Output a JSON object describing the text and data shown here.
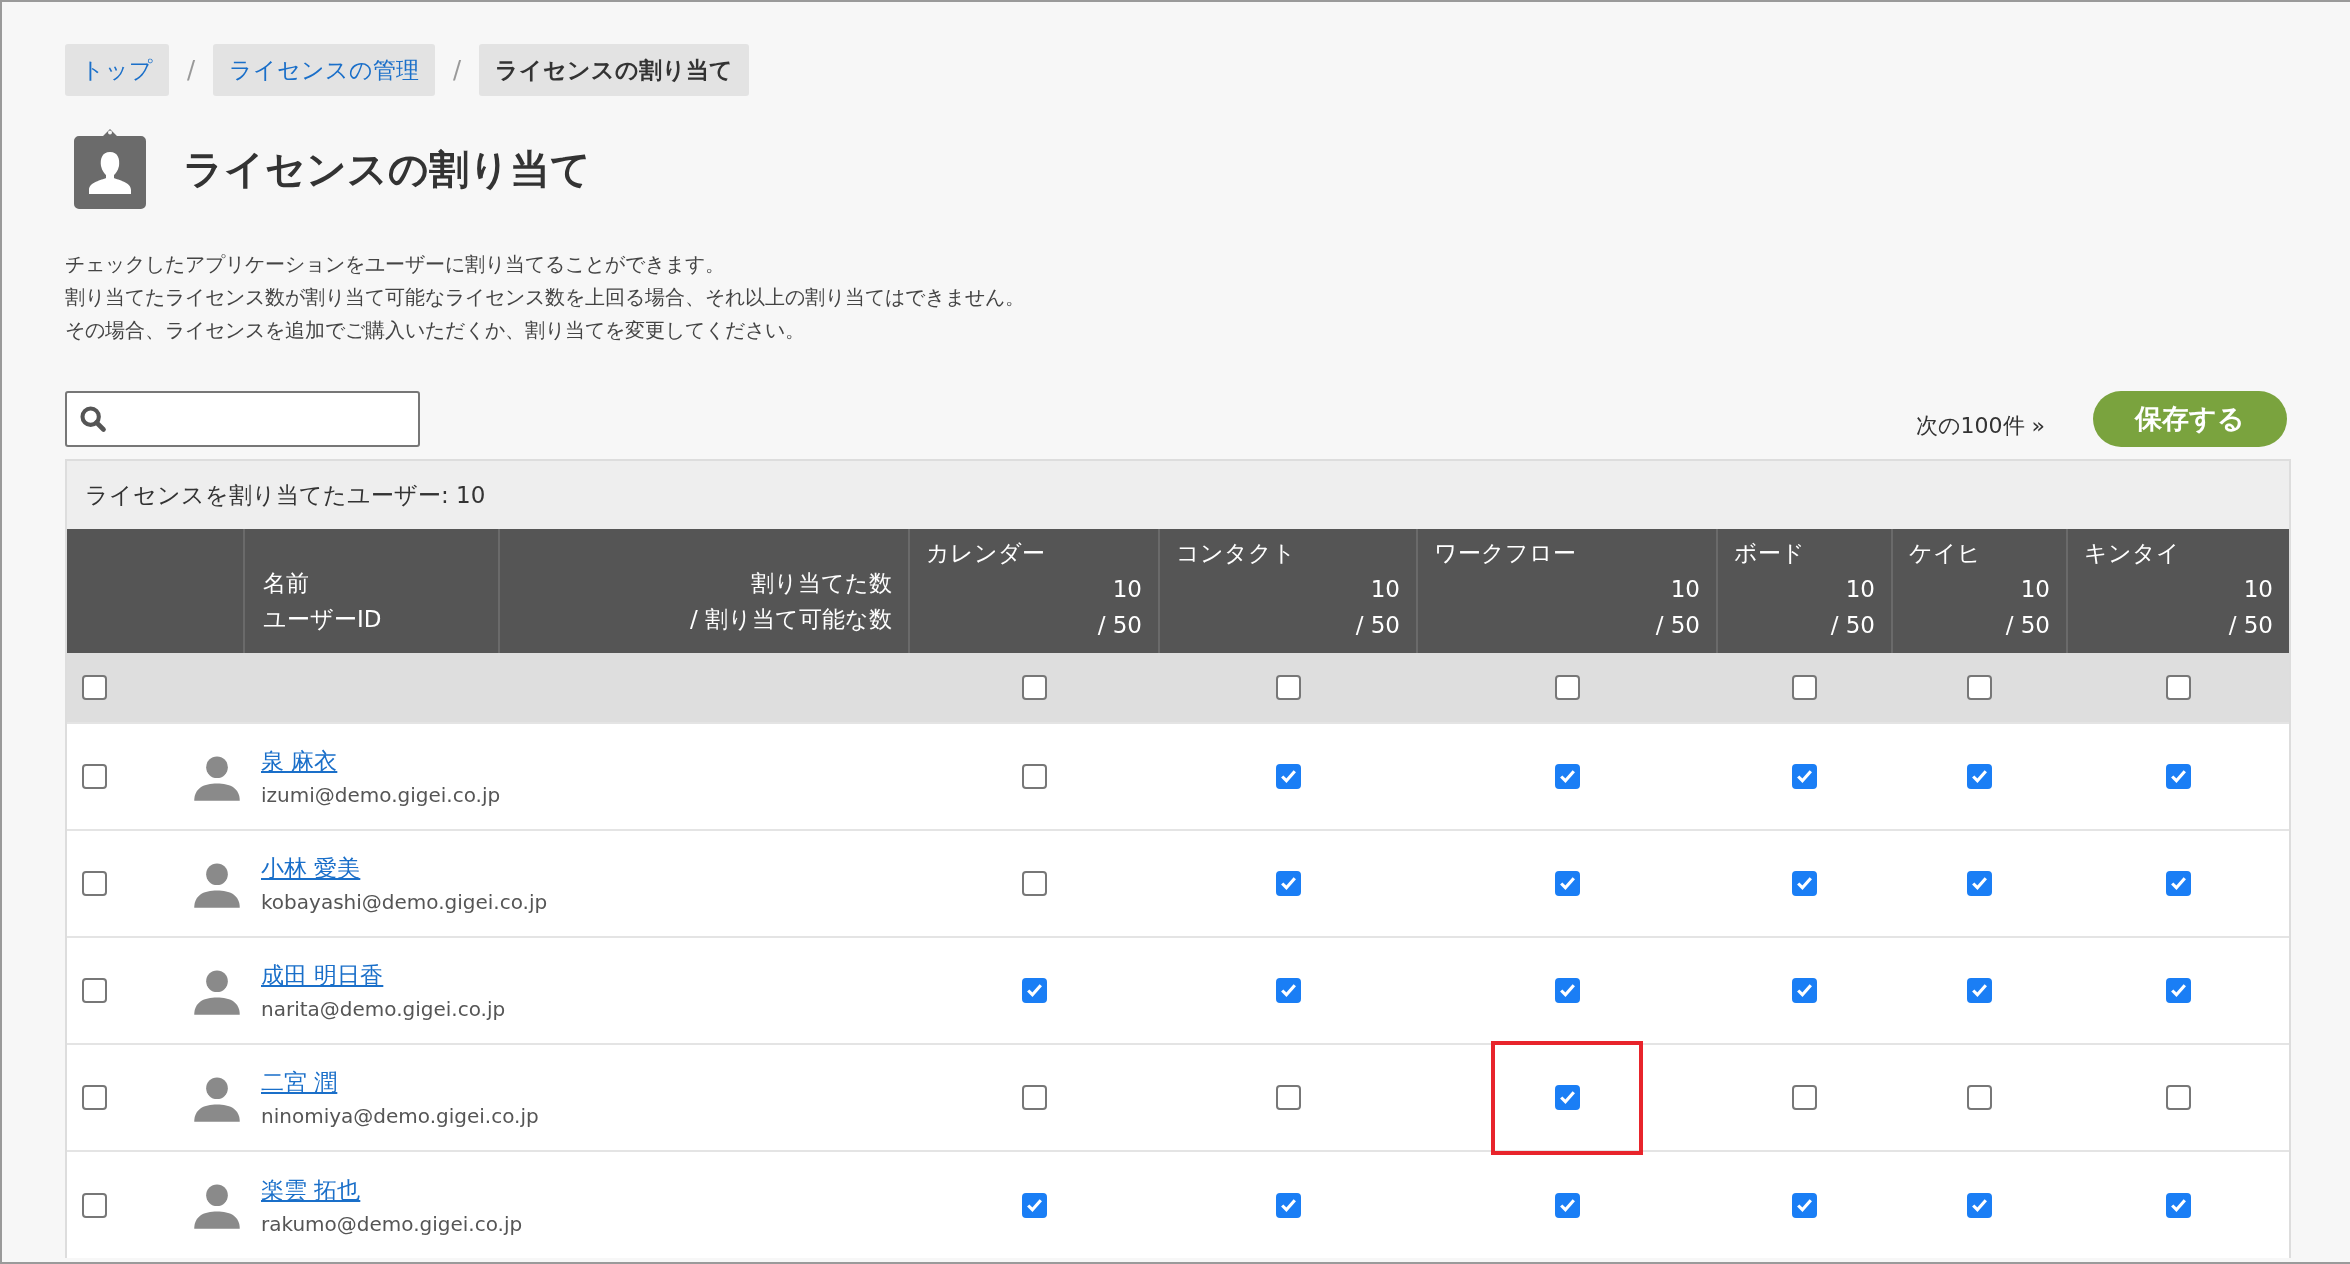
{
  "breadcrumb": [
    {
      "label": "トップ",
      "current": false
    },
    {
      "label": "ライセンスの管理",
      "current": false
    },
    {
      "label": "ライセンスの割り当て",
      "current": true
    }
  ],
  "breadcrumb_separator": "/",
  "title": "ライセンスの割り当て",
  "description": [
    "チェックしたアプリケーションをユーザーに割り当てることができます。",
    "割り当てたライセンス数が割り当て可能なライセンス数を上回る場合、それ以上の割り当てはできません。",
    "その場合、ライセンスを追加でご購入いただくか、割り当てを変更してください。"
  ],
  "next_link": "次の100件 »",
  "save_button": "保存する",
  "summary": "ライセンスを割り当てたユーザー: 10",
  "table": {
    "name_header": [
      "名前",
      "ユーザーID"
    ],
    "count_header": [
      "割り当てた数",
      "/ 割り当て可能な数"
    ],
    "select_all": {
      "checked": false
    },
    "apps": [
      {
        "name": "カレンダー",
        "assigned": "10",
        "total": "/ 50",
        "all_checked": false
      },
      {
        "name": "コンタクト",
        "assigned": "10",
        "total": "/ 50",
        "all_checked": false
      },
      {
        "name": "ワークフロー",
        "assigned": "10",
        "total": "/ 50",
        "all_checked": false
      },
      {
        "name": "ボード",
        "assigned": "10",
        "total": "/ 50",
        "all_checked": false
      },
      {
        "name": "ケイヒ",
        "assigned": "10",
        "total": "/ 50",
        "all_checked": false
      },
      {
        "name": "キンタイ",
        "assigned": "10",
        "total": "/ 50",
        "all_checked": false
      }
    ],
    "rows": [
      {
        "name": "泉 麻衣",
        "user_id": "izumi@demo.gigei.co.jp",
        "checked": false,
        "licenses": [
          {
            "checked": false,
            "highlighted": false
          },
          {
            "checked": true,
            "highlighted": false
          },
          {
            "checked": true,
            "highlighted": false
          },
          {
            "checked": true,
            "highlighted": false
          },
          {
            "checked": true,
            "highlighted": false
          },
          {
            "checked": true,
            "highlighted": false
          }
        ]
      },
      {
        "name": "小林 愛美",
        "user_id": "kobayashi@demo.gigei.co.jp",
        "checked": false,
        "licenses": [
          {
            "checked": false,
            "highlighted": false
          },
          {
            "checked": true,
            "highlighted": false
          },
          {
            "checked": true,
            "highlighted": false
          },
          {
            "checked": true,
            "highlighted": false
          },
          {
            "checked": true,
            "highlighted": false
          },
          {
            "checked": true,
            "highlighted": false
          }
        ]
      },
      {
        "name": "成田 明日香",
        "user_id": "narita@demo.gigei.co.jp",
        "checked": false,
        "licenses": [
          {
            "checked": true,
            "highlighted": false
          },
          {
            "checked": true,
            "highlighted": false
          },
          {
            "checked": true,
            "highlighted": false
          },
          {
            "checked": true,
            "highlighted": false
          },
          {
            "checked": true,
            "highlighted": false
          },
          {
            "checked": true,
            "highlighted": false
          }
        ]
      },
      {
        "name": "二宮 潤",
        "user_id": "ninomiya@demo.gigei.co.jp",
        "checked": false,
        "licenses": [
          {
            "checked": false,
            "highlighted": false
          },
          {
            "checked": false,
            "highlighted": false
          },
          {
            "checked": true,
            "highlighted": true
          },
          {
            "checked": false,
            "highlighted": false
          },
          {
            "checked": false,
            "highlighted": false
          },
          {
            "checked": false,
            "highlighted": false
          }
        ]
      },
      {
        "name": "楽雲 拓也",
        "user_id": "rakumo@demo.gigei.co.jp",
        "checked": false,
        "licenses": [
          {
            "checked": true,
            "highlighted": false
          },
          {
            "checked": true,
            "highlighted": false
          },
          {
            "checked": true,
            "highlighted": false
          },
          {
            "checked": true,
            "highlighted": false
          },
          {
            "checked": true,
            "highlighted": false
          },
          {
            "checked": true,
            "highlighted": false
          }
        ]
      }
    ]
  }
}
